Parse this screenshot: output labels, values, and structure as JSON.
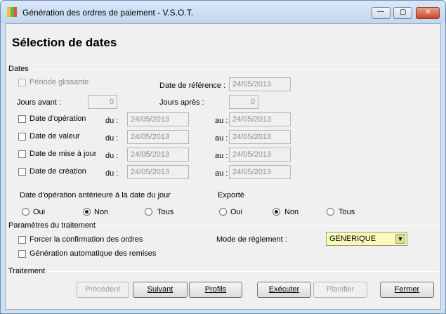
{
  "window": {
    "title": "Génération des ordres de paiement - V.S.O.T.",
    "minimize": "—",
    "maximize": "▢",
    "close": "✕"
  },
  "heading": "Sélection de dates",
  "dates": {
    "section": "Dates",
    "periode_glissante": "Période glissante",
    "date_reference_label": "Date de référence :",
    "date_reference_value": "24/05/2013",
    "jours_avant_label": "Jours avant :",
    "jours_avant_value": "0",
    "jours_apres_label": "Jours après :",
    "jours_apres_value": "0",
    "du_label": "du :",
    "au_label": "au :",
    "rows": [
      {
        "label": "Date d'opération",
        "du": "24/05/2013",
        "au": "24/05/2013"
      },
      {
        "label": "Date de valeur",
        "du": "24/05/2013",
        "au": "24/05/2013"
      },
      {
        "label": "Date de mise à jour",
        "du": "24/05/2013",
        "au": "24/05/2013"
      },
      {
        "label": "Date de création",
        "du": "24/05/2013",
        "au": "24/05/2013"
      }
    ],
    "anterieure_label": "Date d'opération antérieure à la date du jour",
    "exporte_label": "Exporté",
    "radio_oui": "Oui",
    "radio_non": "Non",
    "radio_tous": "Tous",
    "anterieure_selected": "Non",
    "exporte_selected": "Non"
  },
  "traitement_params": {
    "section": "Paramètres du traitement",
    "forcer": "Forcer la confirmation des ordres",
    "generation": "Génération automatique des remises",
    "mode_label": "Mode de règlement :",
    "mode_value": "GENERIQUE"
  },
  "traitement": {
    "section": "Traitement",
    "buttons": {
      "precedent": "Précédent",
      "suivant": "Suivant",
      "profils": "Profils",
      "executer": "Exécuter",
      "planifier": "Planifier",
      "fermer": "Fermer"
    }
  },
  "colors": {
    "accent": "#fbfbbe",
    "titlebar": "#c2d7ef"
  }
}
